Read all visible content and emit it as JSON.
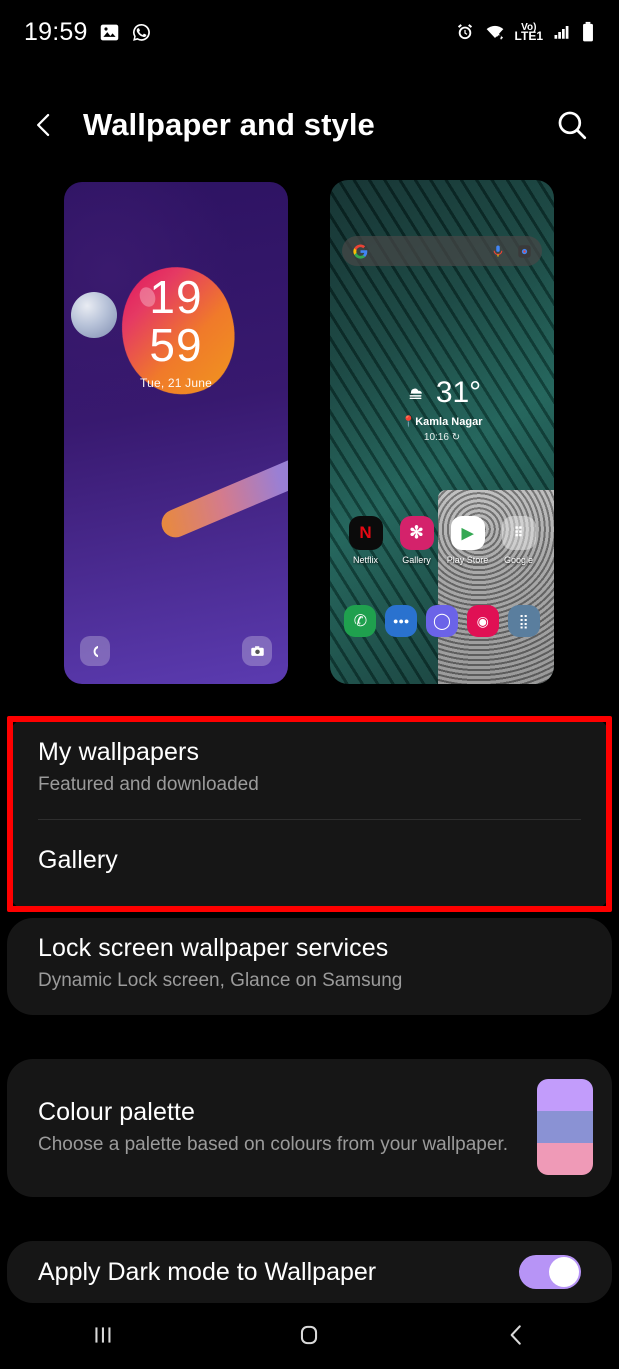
{
  "status_bar": {
    "time": "19:59",
    "left_icons": [
      "image-icon",
      "whatsapp-icon"
    ],
    "right_icons": [
      "alarm-icon",
      "wifi-icon",
      "volte-lte1-icon",
      "signal-bars-icon",
      "battery-icon"
    ],
    "network_label_top": "Vo)",
    "network_label_bottom": "LTE1"
  },
  "app_bar": {
    "back_icon": "chevron-left-icon",
    "title": "Wallpaper and style",
    "search_icon": "search-icon"
  },
  "previews": {
    "lock_screen": {
      "name": "lock-screen-preview",
      "hours": "19",
      "minutes": "59",
      "date": "Tue, 21 June",
      "left_shortcut_icon": "phone-icon",
      "right_shortcut_icon": "camera-icon",
      "background_color": "#2d1362"
    },
    "home_screen": {
      "name": "home-screen-preview",
      "search_bar": {
        "google_icon": "google-g-icon",
        "mic_icon": "microphone-icon",
        "lens_icon": "google-lens-icon"
      },
      "weather": {
        "icon": "cloudy-weather-icon",
        "temperature": "31°",
        "location": "Kamla Nagar",
        "time": "10:16",
        "refresh_icon": "refresh-icon"
      },
      "apps": [
        {
          "label": "Netflix",
          "icon": "netflix-icon",
          "glyph": "N",
          "color": "#0b0b0b",
          "text_color": "#e50914"
        },
        {
          "label": "Gallery",
          "icon": "gallery-icon",
          "glyph": "✻",
          "color": "#d4226b",
          "text_color": "#ffffff"
        },
        {
          "label": "Play Store",
          "icon": "play-store-icon",
          "glyph": "▶",
          "color": "#ffffff",
          "text_color": "#34a853"
        },
        {
          "label": "Google",
          "icon": "google-folder-icon",
          "glyph": "⠿",
          "color": "rgba(230,230,230,0.55)",
          "text_color": "#ffffff"
        }
      ],
      "dock": [
        {
          "icon": "phone-icon",
          "glyph": "✆",
          "color": "#1fa04e"
        },
        {
          "icon": "messages-icon",
          "glyph": "●●●",
          "color": "#2a72cf"
        },
        {
          "icon": "internet-icon",
          "glyph": "◯",
          "color": "#6b63e8"
        },
        {
          "icon": "camera-icon",
          "glyph": "◉",
          "color": "#e01054"
        },
        {
          "icon": "apps-icon",
          "glyph": "⣿",
          "color": "#5a7e9e"
        }
      ],
      "background_color": "#12413c"
    }
  },
  "settings": {
    "wallpapers_card": {
      "highlighted": true,
      "highlight_color": "#fe0000",
      "rows": [
        {
          "name": "my-wallpapers",
          "title": "My wallpapers",
          "subtitle": "Featured and downloaded"
        },
        {
          "name": "gallery",
          "title": "Gallery",
          "subtitle": ""
        }
      ]
    },
    "services_card": {
      "name": "lock-screen-wallpaper-services",
      "title": "Lock screen wallpaper services",
      "subtitle": "Dynamic Lock screen, Glance on Samsung"
    },
    "palette_card": {
      "name": "colour-palette",
      "title": "Colour palette",
      "subtitle": "Choose a palette based on colours from your wallpaper.",
      "swatch_colors": [
        "#c29cfb",
        "#8a92d4",
        "#ef9ab7"
      ]
    },
    "dark_mode_card": {
      "name": "apply-dark-mode-to-wallpaper",
      "label": "Apply Dark mode to Wallpaper",
      "toggle_on": true,
      "toggle_color": "#b794f6"
    }
  },
  "nav_bar": {
    "recents_icon": "recents-icon",
    "home_icon": "home-icon",
    "back_icon": "back-icon"
  }
}
